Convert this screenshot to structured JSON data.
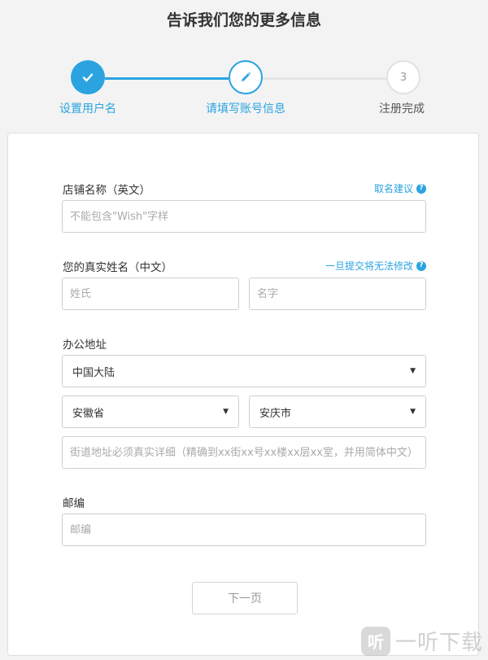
{
  "page_title": "告诉我们您的更多信息",
  "stepper": {
    "steps": [
      {
        "number": "",
        "label": "设置用户名",
        "state": "completed"
      },
      {
        "number": "",
        "label": "请填写账号信息",
        "state": "active"
      },
      {
        "number": "3",
        "label": "注册完成",
        "state": "pending"
      }
    ]
  },
  "form": {
    "store_name": {
      "label": "店铺名称（英文）",
      "hint": "取名建议",
      "placeholder": "不能包含\"Wish\"字样"
    },
    "real_name": {
      "label": "您的真实姓名（中文）",
      "hint": "一旦提交将无法修改",
      "surname_placeholder": "姓氏",
      "given_name_placeholder": "名字"
    },
    "office_address": {
      "label": "办公地址",
      "country": "中国大陆",
      "province": "安徽省",
      "city": "安庆市",
      "street_placeholder": "街道地址必须真实详细（精确到xx街xx号xx楼xx层xx室，并用简体中文）"
    },
    "postal_code": {
      "label": "邮编",
      "placeholder": "邮编"
    },
    "next_label": "下一页"
  },
  "watermark": {
    "logo_char": "听",
    "text": "一听下载"
  },
  "colors": {
    "accent": "#2aa3e0",
    "border": "#cfcfcf",
    "background": "#f3f3f3"
  }
}
